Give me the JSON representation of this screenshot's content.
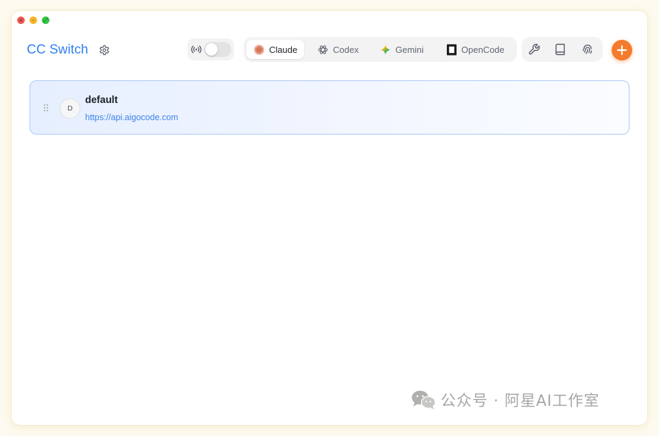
{
  "app": {
    "title": "CC Switch"
  },
  "window_controls": {
    "close": "×",
    "minimize": "–",
    "maximize": "⤢"
  },
  "toolbar": {
    "proxy_enabled": false,
    "tabs": [
      {
        "label": "Claude",
        "active": true,
        "icon": "claude-starburst-icon"
      },
      {
        "label": "Codex",
        "active": false,
        "icon": "openai-knot-icon"
      },
      {
        "label": "Gemini",
        "active": false,
        "icon": "gemini-sparkle-icon"
      },
      {
        "label": "OpenCode",
        "active": false,
        "icon": "opencode-square-icon"
      }
    ],
    "tools": [
      "wrench-icon",
      "book-icon",
      "fingerprint-icon"
    ],
    "add_label": "+"
  },
  "providers": [
    {
      "initial": "D",
      "name": "default",
      "url": "https://api.aigocode.com"
    }
  ],
  "watermark": {
    "text": "公众号 · 阿星AI工作室"
  },
  "colors": {
    "accent": "#2f7ff0",
    "add_button": "#f47b2c",
    "claude": "#d97757"
  }
}
